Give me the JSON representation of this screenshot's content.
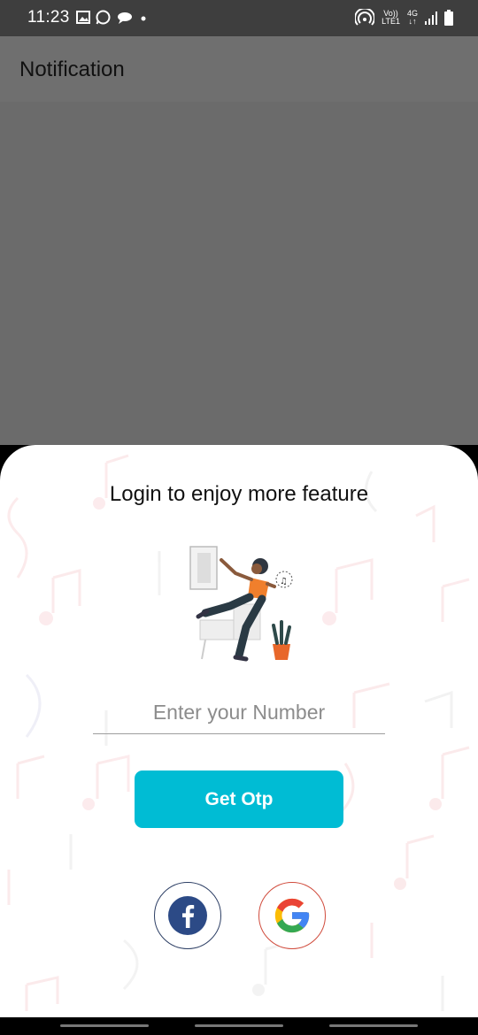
{
  "status_bar": {
    "time": "11:23",
    "network_top": "Vo))",
    "network_bottom": "LTE1",
    "signal_top": "4G",
    "signal_bottom": "↓↑"
  },
  "app_bar": {
    "title": "Notification"
  },
  "login_sheet": {
    "title": "Login to enjoy more feature",
    "phone_placeholder": "Enter your Number",
    "otp_button_label": "Get Otp",
    "social": [
      {
        "name": "facebook",
        "icon": "facebook-icon",
        "color": "#2c4a86"
      },
      {
        "name": "google",
        "icon": "google-icon",
        "colors": [
          "#ea4335",
          "#fbbc05",
          "#34a853",
          "#4285f4"
        ]
      }
    ]
  },
  "colors": {
    "accent": "#00bcd4",
    "scrim": "#6b6b6b",
    "status_bar": "#3e3e3e"
  }
}
